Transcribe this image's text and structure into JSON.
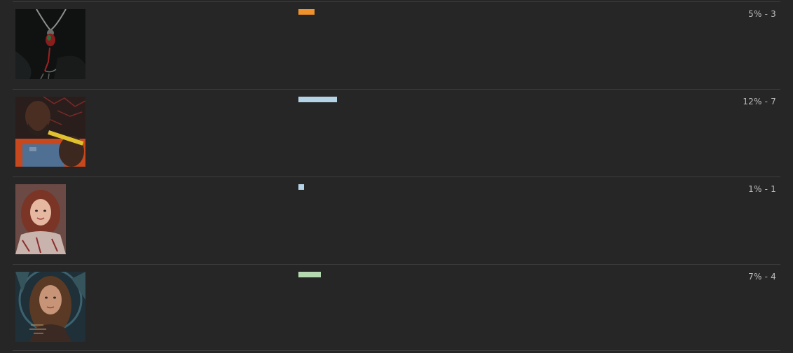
{
  "options": [
    {
      "image": "necklace-pendant-photo",
      "percent_label": "5%",
      "separator": " - ",
      "votes_label": "3",
      "fraction": 0.05,
      "bar_color": "#f0922c"
    },
    {
      "image": "man-with-bat-photo",
      "percent_label": "12%",
      "separator": " - ",
      "votes_label": "7",
      "fraction": 0.12,
      "bar_color": "#b4d3e6"
    },
    {
      "image": "red-haired-girl-photo",
      "percent_label": "1%",
      "separator": " - ",
      "votes_label": "1",
      "fraction": 0.01,
      "bar_color": "#b4d3e6"
    },
    {
      "image": "long-haired-woman-photo",
      "percent_label": "7%",
      "separator": " - ",
      "votes_label": "4",
      "fraction": 0.07,
      "bar_color": "#b5dab2"
    }
  ]
}
